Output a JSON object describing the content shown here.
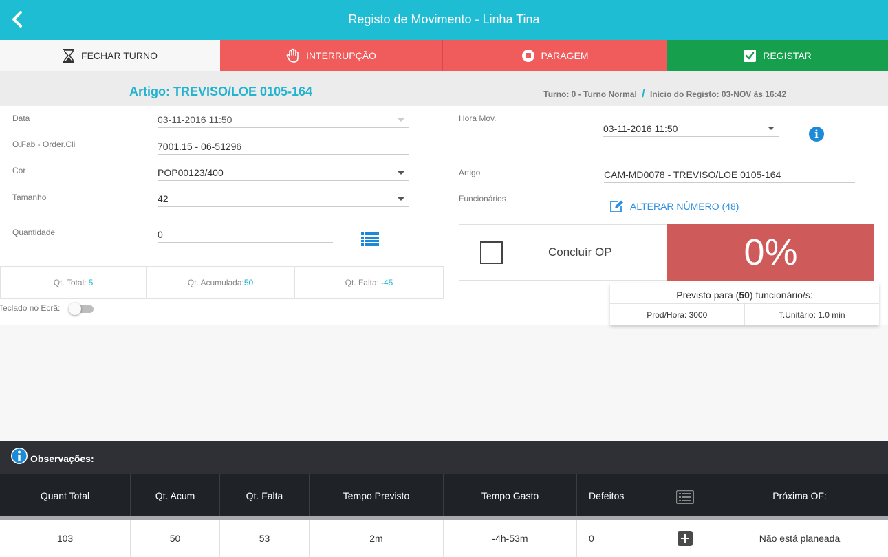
{
  "header": {
    "title": "Registo de Movimento - Linha Tina"
  },
  "actions": {
    "fechar_turno": "FECHAR TURNO",
    "interrupcao": "INTERRUPÇÃO",
    "paragem": "PARAGEM",
    "registar": "REGISTAR"
  },
  "subheader": {
    "artigo": "Artigo: TREVISO/LOE 0105-164",
    "turno": "Turno: 0 - Turno Normal",
    "separator": "/",
    "inicio": "Início do Registo: 03-NOV às 16:42"
  },
  "form": {
    "data_label": "Data",
    "data_value": "03-11-2016 11:50",
    "ofab_label": "O.Fab - Order.Cli",
    "ofab_value": "7001.15 - 06-51296",
    "cor_label": "Cor",
    "cor_value": "POP00123/400",
    "tamanho_label": "Tamanho",
    "tamanho_value": "42",
    "quantidade_label": "Quantidade",
    "quantidade_value": "0",
    "hora_mov_label": "Hora Mov.",
    "hora_mov_value": "03-11-2016 11:50",
    "artigo_label": "Artigo",
    "artigo_value": "CAM-MD0078 - TREVISO/LOE 0105-164",
    "funcionarios_label": "Funcionários",
    "alterar_numero": "ALTERAR NÚMERO (48)"
  },
  "stats": {
    "total_label": "Qt. Total:",
    "total_value": "5",
    "acumulada_label": "Qt. Acumulada:",
    "acumulada_value": "50",
    "falta_label": "Qt. Falta:",
    "falta_value": "-45"
  },
  "teclado": {
    "label": "Teclado no Ecrã:",
    "enabled": false
  },
  "concluir": {
    "label": "Concluír OP",
    "checked": false,
    "percent": "0%",
    "color": "#cf5a5a"
  },
  "previsto": {
    "prefix": "Previsto para (",
    "count": "50",
    "suffix": ") funcionário/s:",
    "prod_hora": "Prod/Hora: 3000",
    "t_unitario": "T.Unitário: 1.0 min"
  },
  "observacoes": {
    "label": "Observações:"
  },
  "table": {
    "headers": [
      "Quant Total",
      "Qt. Acum",
      "Qt. Falta",
      "Tempo Previsto",
      "Tempo Gasto",
      "Defeitos",
      "Próxima OF:"
    ],
    "row": [
      "103",
      "50",
      "53",
      "2m",
      "-4h-53m",
      "0",
      "Não está planeada"
    ]
  },
  "colors": {
    "header": "#1fbdd4",
    "interrupcao": "#f05b5b",
    "registar": "#16a04d",
    "accent": "#21b3cf"
  }
}
